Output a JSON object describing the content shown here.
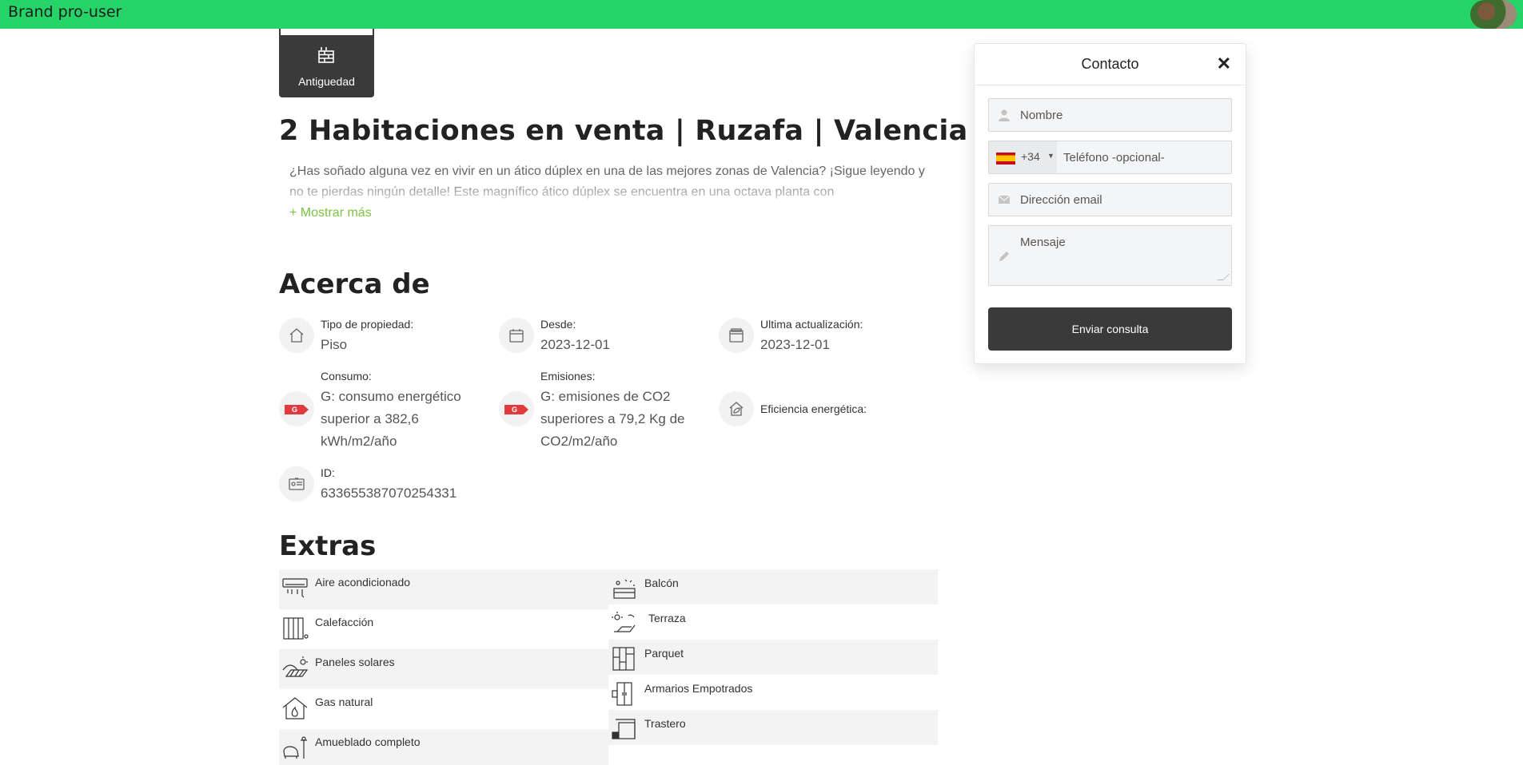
{
  "topbar": {
    "brand": "Brand pro-user",
    "accent_color": "#25d366"
  },
  "gallery_tab": {
    "label": "Antiguedad",
    "icon": "brick-wall-icon"
  },
  "listing": {
    "title": "2 Habitaciones en venta | Ruzafa | Valencia",
    "description": "¿Has soñado alguna vez en vivir en un ático dúplex en una de las mejores zonas de Valencia? ¡Sigue leyendo y no te pierdas ningún detalle! Este magnífico ático dúplex se encuentra en una octava planta con",
    "show_more": "+ Mostrar más"
  },
  "about": {
    "heading": "Acerca de",
    "items": [
      {
        "key": "Tipo de propiedad:",
        "value": "Piso",
        "icon": "house-icon"
      },
      {
        "key": "Desde:",
        "value": "2023-12-01",
        "icon": "calendar-icon"
      },
      {
        "key": "Ultima actualización:",
        "value": "2023-12-01",
        "icon": "calendar-update-icon"
      },
      {
        "key": "Consumo:",
        "value": "G: consumo energético superior a 382,6 kWh/m2/año",
        "icon": "energy-rating-g-icon",
        "badge": "G"
      },
      {
        "key": "Emisiones:",
        "value": "G: emisiones de CO2 superiores a 79,2 Kg de CO2/m2/año",
        "icon": "energy-rating-g-icon",
        "badge": "G"
      },
      {
        "key": "Eficiencia energética:",
        "value": "",
        "icon": "eco-house-icon"
      },
      {
        "key": "ID:",
        "value": "633655387070254331",
        "icon": "id-card-icon"
      }
    ]
  },
  "extras": {
    "heading": "Extras",
    "left": [
      {
        "label": "Aire acondicionado",
        "icon": "air-conditioner-icon"
      },
      {
        "label": "Calefacción",
        "icon": "radiator-icon"
      },
      {
        "label": "Paneles solares",
        "icon": "solar-panel-icon"
      },
      {
        "label": "Gas natural",
        "icon": "gas-flame-house-icon"
      },
      {
        "label": "Amueblado completo",
        "icon": "furniture-icon"
      }
    ],
    "right": [
      {
        "label": "Balcón",
        "icon": "balcony-icon"
      },
      {
        "label": "Terraza",
        "icon": "terrace-icon"
      },
      {
        "label": "Parquet",
        "icon": "parquet-icon"
      },
      {
        "label": "Armarios Empotrados",
        "icon": "wardrobe-icon"
      },
      {
        "label": "Trastero",
        "icon": "storage-room-icon"
      }
    ]
  },
  "contact": {
    "title": "Contacto",
    "close": "✕",
    "name_placeholder": "Nombre",
    "phone_code": "+34",
    "phone_placeholder": "Teléfono -opcional-",
    "email_placeholder": "Dirección email",
    "message_placeholder": "Mensaje",
    "submit": "Enviar consulta"
  }
}
